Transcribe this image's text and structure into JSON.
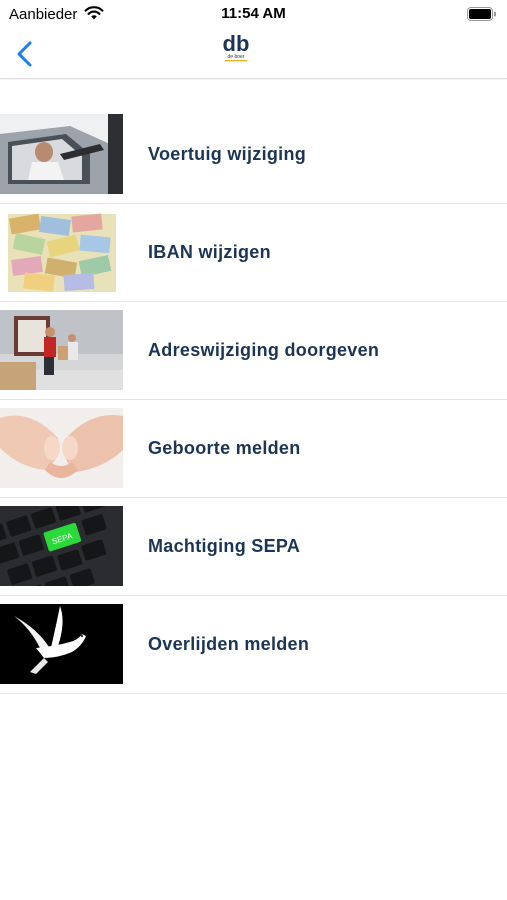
{
  "status": {
    "carrier": "Aanbieder",
    "time": "11:54 AM"
  },
  "nav": {
    "back_icon": "chevron-left-icon",
    "logo_text": "db",
    "logo_sub": "de boer",
    "accent": "#1a7cf2",
    "brand": "#1c3557"
  },
  "items": [
    {
      "label": "Voertuig wijziging",
      "image": "car-driver-photo"
    },
    {
      "label": "IBAN wijzigen",
      "image": "euro-banknotes-photo"
    },
    {
      "label": "Adreswijziging doorgeven",
      "image": "moving-boxes-photo"
    },
    {
      "label": "Geboorte melden",
      "image": "baby-feet-hands-photo"
    },
    {
      "label": "Machtiging SEPA",
      "image": "sepa-keyboard-photo"
    },
    {
      "label": "Overlijden melden",
      "image": "white-dove-photo"
    }
  ]
}
